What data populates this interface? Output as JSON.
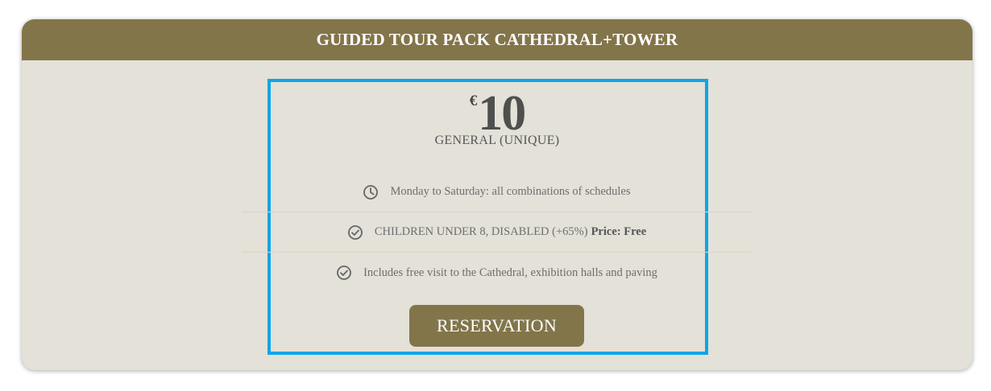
{
  "card": {
    "title": "GUIDED TOUR PACK CATHEDRAL+TOWER"
  },
  "price": {
    "currency": "€",
    "amount": "10",
    "type": "GENERAL (UNIQUE)"
  },
  "features": [
    {
      "icon": "clock-icon",
      "text": "Monday to Saturday: all combinations of schedules",
      "bold": ""
    },
    {
      "icon": "check-circle-icon",
      "text": "CHILDREN UNDER 8, DISABLED (+65%)",
      "bold": "Price: Free"
    },
    {
      "icon": "check-circle-icon",
      "text": "Includes free visit to the Cathedral, exhibition halls and paving",
      "bold": ""
    }
  ],
  "actions": {
    "reservation_label": "RESERVATION"
  },
  "colors": {
    "brand": "#83754a",
    "card_background": "#e3e1d8",
    "highlight": "#0ea5e9"
  }
}
